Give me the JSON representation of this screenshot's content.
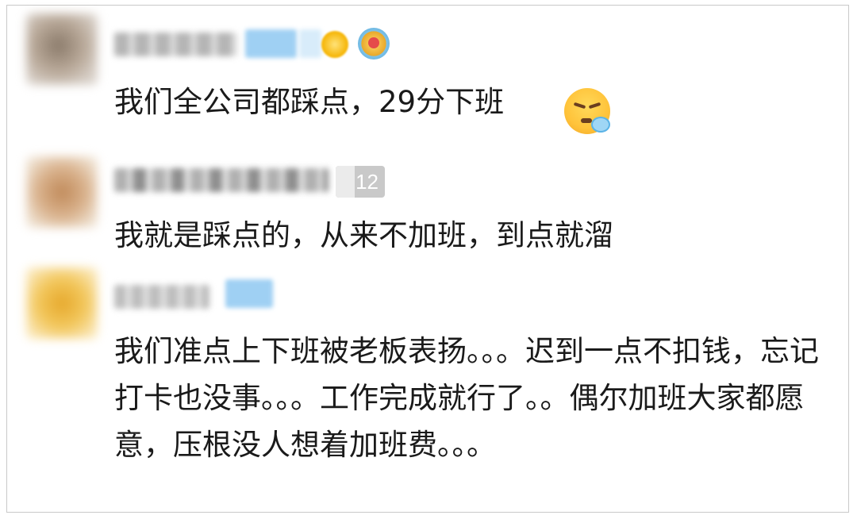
{
  "comments": [
    {
      "text": "我们全公司都踩点，29分下班",
      "emoji_icon": "sleepy-face-emoji"
    },
    {
      "level": "12",
      "text": "我就是踩点的，从来不加班，到点就溜"
    },
    {
      "text": "我们准点上下班被老板表扬。。。迟到一点不扣钱，忘记打卡也没事。。。工作完成就行了。。偶尔加班大家都愿意，压根没人想着加班费。。。"
    }
  ]
}
